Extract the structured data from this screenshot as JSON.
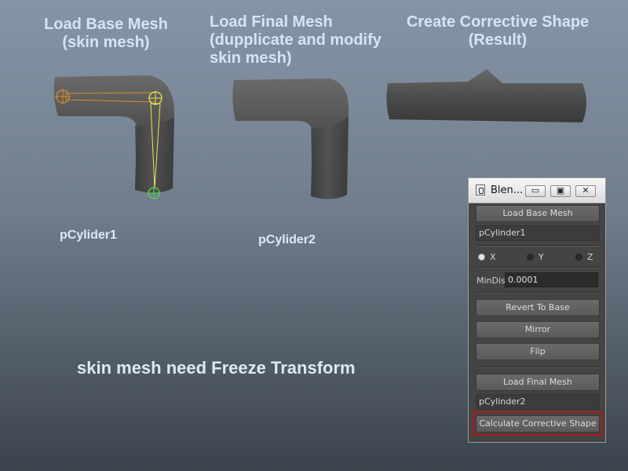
{
  "headings": {
    "base_line1": "Load Base Mesh",
    "base_line2": "(skin mesh)",
    "final_line1": "Load Final Mesh",
    "final_line2": "(dupplicate and modify",
    "final_line3": "skin mesh)",
    "result_line1": "Create Corrective Shape",
    "result_line2": "(Result)"
  },
  "mesh_labels": {
    "base": "pCylider1",
    "final": "pCylider2"
  },
  "note": "skin mesh need Freeze Transform",
  "window": {
    "title": "Blen...",
    "minimize": "▭",
    "maximize": "▣",
    "close": "✕",
    "load_base_button": "Load Base Mesh",
    "base_mesh_field": "pCylinder1",
    "axis_x": "X",
    "axis_y": "Y",
    "axis_z": "Z",
    "selected_axis": "X",
    "mindis_label": "MinDis:",
    "mindis_value": "0.0001",
    "revert_button": "Revert To Base",
    "mirror_button": "Mirror",
    "flip_button": "Flip",
    "load_final_button": "Load Final Mesh",
    "final_mesh_field": "pCylinder2",
    "calculate_button": "Calculate Corrective Shape"
  },
  "colors": {
    "heading_text": "#d6e4f5",
    "mesh_body": "#4a4a4a",
    "joint_orange": "#e08a2a",
    "joint_yellow": "#e8e84a",
    "joint_green": "#4fd94a",
    "highlight_border": "#b01818"
  }
}
